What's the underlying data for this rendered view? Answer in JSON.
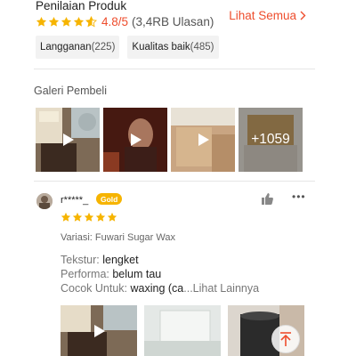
{
  "rating": {
    "title": "Penilaian Produk",
    "score": "4.8/5",
    "count": "(3,4RB Ulasan)",
    "stars_value": 4.8,
    "see_all": "Lihat Semua"
  },
  "chips": [
    {
      "label": "Langganan",
      "count": "(225)"
    },
    {
      "label": "Kualitas baik",
      "count": "(485)"
    }
  ],
  "gallery": {
    "title": "Galeri Pembeli",
    "more_count": "+1059"
  },
  "review": {
    "username": "r*****_",
    "badge": "Gold",
    "stars_value": 5,
    "variation": "Variasi: Fuwari Sugar Wax",
    "lines": [
      {
        "key": "Tekstur: ",
        "value": "lengket"
      },
      {
        "key": "Performa: ",
        "value": "belum tau"
      },
      {
        "key": "Cocok Untuk: ",
        "value": "waxing (ca",
        "more": "...Lihat Lainnya"
      }
    ]
  },
  "colors": {
    "accent": "#ee4d2d",
    "star": "#f6b400",
    "badge": "#f6b400"
  },
  "icons": [
    "star-icon",
    "star-half-icon",
    "chevron-right-icon",
    "play-icon",
    "thumbs-up-icon",
    "more-dots-icon",
    "arrow-up-icon"
  ]
}
